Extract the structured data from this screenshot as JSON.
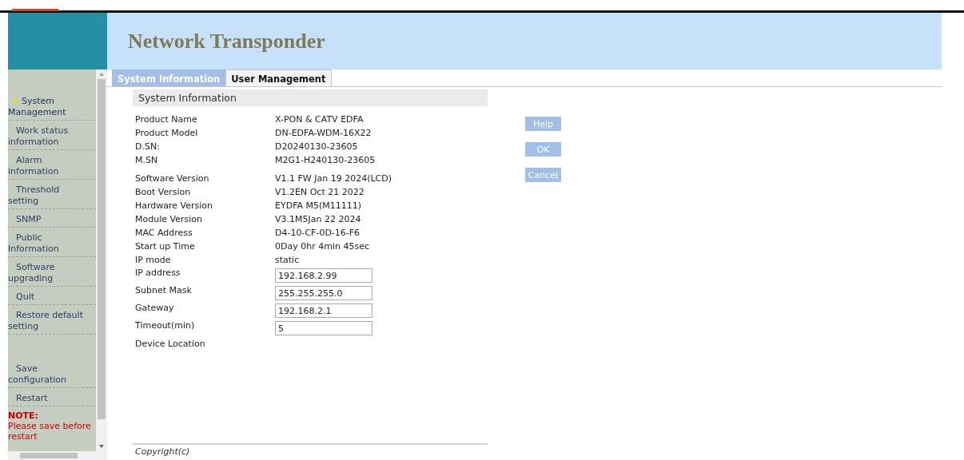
{
  "header": {
    "title": "Network Transponder"
  },
  "sidebar": {
    "items": [
      {
        "label": "System Management",
        "selected": true
      },
      {
        "label": "Work status information",
        "selected": false
      },
      {
        "label": "Alarm information",
        "selected": false
      },
      {
        "label": "Threshold setting",
        "selected": false
      },
      {
        "label": "SNMP",
        "selected": false
      },
      {
        "label": "Public Information",
        "selected": false
      },
      {
        "label": "Software upgrading",
        "selected": false
      },
      {
        "label": "Quit",
        "selected": false
      },
      {
        "label": "Restore default setting",
        "selected": false
      }
    ],
    "bottom_items": [
      {
        "label": "Save configuration",
        "selected": false
      },
      {
        "label": "Restart",
        "selected": false
      }
    ],
    "note": {
      "title": "NOTE:",
      "text": "Please save before restart"
    }
  },
  "tabs": [
    {
      "label": "System Information",
      "selected": true
    },
    {
      "label": "User Management",
      "selected": false
    }
  ],
  "section": {
    "title": "System Information"
  },
  "groups": [
    [
      {
        "label": "Product Name",
        "kind": "text",
        "value": "X-PON & CATV EDFA"
      },
      {
        "label": "Product Model",
        "kind": "text",
        "value": "DN-EDFA-WDM-16X22"
      },
      {
        "label": "D.SN:",
        "kind": "text",
        "value": "D20240130-23605"
      },
      {
        "label": "M.SN",
        "kind": "text",
        "value": "M2G1-H240130-23605"
      }
    ],
    [
      {
        "label": "Software Version",
        "kind": "text",
        "value": "V1.1 FW Jan 19 2024(LCD)"
      },
      {
        "label": "Boot Version",
        "kind": "text",
        "value": "V1.2EN Oct 21 2022"
      },
      {
        "label": "Hardware Version",
        "kind": "text",
        "value": "EYDFA M5(M11111)"
      },
      {
        "label": "Module Version",
        "kind": "text",
        "value": "V3.1M5Jan 22 2024"
      },
      {
        "label": "MAC Address",
        "kind": "text",
        "value": "D4-10-CF-0D-16-F6"
      },
      {
        "label": "Start up Time",
        "kind": "text",
        "value": " 0Day 0hr 4min 45sec"
      },
      {
        "label": "IP mode",
        "kind": "text",
        "value": "static"
      },
      {
        "label": "IP address",
        "kind": "field",
        "value": "192.168.2.99"
      },
      {
        "label": "Subnet Mask",
        "kind": "field",
        "value": "255.255.255.0"
      },
      {
        "label": "Gateway",
        "kind": "field",
        "value": "192.168.2.1"
      },
      {
        "label": "Timeout(min)",
        "kind": "field",
        "value": "5"
      },
      {
        "label": "Device Location",
        "kind": "label"
      }
    ]
  ],
  "buttons": [
    "Help",
    "OK",
    "Cancel"
  ],
  "footer": {
    "copyright": "Copyright(c)"
  }
}
